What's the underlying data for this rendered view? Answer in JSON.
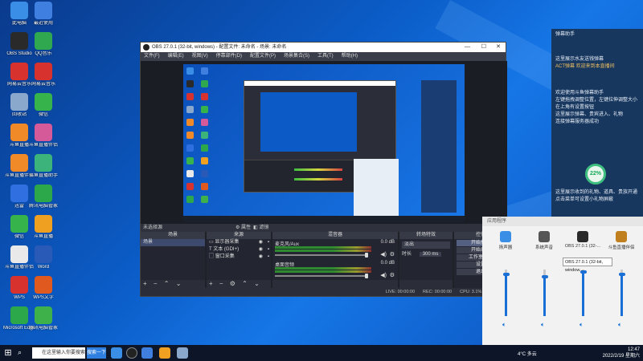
{
  "desktop": {
    "icons": [
      {
        "label": "此电脑",
        "color": "#3a8ee6"
      },
      {
        "label": "最近使用",
        "color": "#3f7fe0"
      },
      {
        "label": "OBS Studio",
        "color": "#2a2a2a"
      },
      {
        "label": "QQ音乐",
        "color": "#2fa84f"
      },
      {
        "label": "网易云音乐",
        "color": "#d8322e"
      },
      {
        "label": "网易云音乐",
        "color": "#d8322e"
      },
      {
        "label": "回收站",
        "color": "#8aa8cc"
      },
      {
        "label": "微信",
        "color": "#36b34a"
      },
      {
        "label": "斗鱼直播",
        "color": "#f08a28"
      },
      {
        "label": "斗鱼直播伴侣",
        "color": "#d45a9a"
      },
      {
        "label": "斗鱼直播伴侣",
        "color": "#f08a28"
      },
      {
        "label": "斗鱼直播助手",
        "color": "#3cb37a"
      },
      {
        "label": "迅雷",
        "color": "#2f6fe0"
      },
      {
        "label": "腾讯电脑管家",
        "color": "#2ca84a"
      },
      {
        "label": "微信",
        "color": "#36b34a"
      },
      {
        "label": "斗鱼直播",
        "color": "#f0a020"
      },
      {
        "label": "斗鱼直播伴侣",
        "color": "#e9e9e9"
      },
      {
        "label": "Word",
        "color": "#2a5ab8"
      },
      {
        "label": "WPS",
        "color": "#d8322e"
      },
      {
        "label": "WPS文字",
        "color": "#e05a20"
      },
      {
        "label": "Microsoft Edge",
        "color": "#2ca84a"
      },
      {
        "label": "腾讯电脑管家",
        "color": "#3fb14a"
      }
    ]
  },
  "obs": {
    "title": "OBS 27.0.1 (32-bit, windows) - 配置文件: 未命名 - 场景: 未命名",
    "menu": [
      "文件(F)",
      "编辑(E)",
      "视图(V)",
      "停靠部件(D)",
      "配置文件(P)",
      "场景集合(S)",
      "工具(T)",
      "帮助(H)"
    ],
    "transition_bar": {
      "label": "未选择源",
      "props": "属性",
      "filters": "滤镜"
    },
    "scenes": {
      "header": "场景",
      "items": [
        "场景"
      ]
    },
    "sources": {
      "header": "来源",
      "items": [
        "显示器采集",
        "文本 (GDI+)",
        "窗口采集"
      ]
    },
    "mixer": {
      "header": "混音器",
      "channels": [
        {
          "name": "麦克风/Aux",
          "db": "0.0 dB"
        },
        {
          "name": "桌面音频",
          "db": "0.0 dB"
        }
      ]
    },
    "transitions": {
      "header": "转场特效",
      "type": "淡出",
      "duration_label": "时长",
      "duration_value": "300 ms"
    },
    "controls": {
      "header": "控件",
      "buttons": [
        "开始推流",
        "开始录制",
        "工作室模式",
        "设置",
        "退出"
      ]
    },
    "status": {
      "live": "LIVE: 00:00:00",
      "rec": "REC: 00:00:00",
      "cpu": "CPU: 3.1%, 30.00 fps"
    }
  },
  "notification": {
    "title": "弹幕助手",
    "line1": "这里展示水友送钱弹幕",
    "line2": "ACT弹幕  欢迎来到本直播间",
    "line3": "欢迎使用斗鱼弹幕助手",
    "line4": "左键拖拽调整位置，左键拉伸调整大小",
    "line5": "在上角有设置按钮",
    "line6": "这里展示弹幕、贵宾进入、礼物",
    "line7": "连接弹幕服务器成功",
    "gauge": "22%",
    "gauge_value": 0.22,
    "line8": "这里展示收到的礼物、道具、贵族开通",
    "line9": "点击菜单可设置小礼物屏蔽"
  },
  "volume_mixer": {
    "header": "应用程序",
    "apps": [
      {
        "name": "扬声器",
        "color": "#3a8ee6",
        "level": 0.9
      },
      {
        "name": "系统声音",
        "color": "#555555",
        "level": 0.85
      },
      {
        "name": "OBS 27.0.1 (32-...",
        "color": "#2a2a2a",
        "level": 0.95
      },
      {
        "name": "斗鱼直播伴侣",
        "color": "#c08020",
        "level": 0.9
      }
    ],
    "tooltip": "OBS 27.0.1 (32-bit, window..."
  },
  "taskbar": {
    "search_placeholder": "在这里输入你要搜索的内容",
    "search_button": "搜索一下",
    "weather": "4°C 多云",
    "time": "12:47",
    "date": "2022/2/19 星期六"
  }
}
